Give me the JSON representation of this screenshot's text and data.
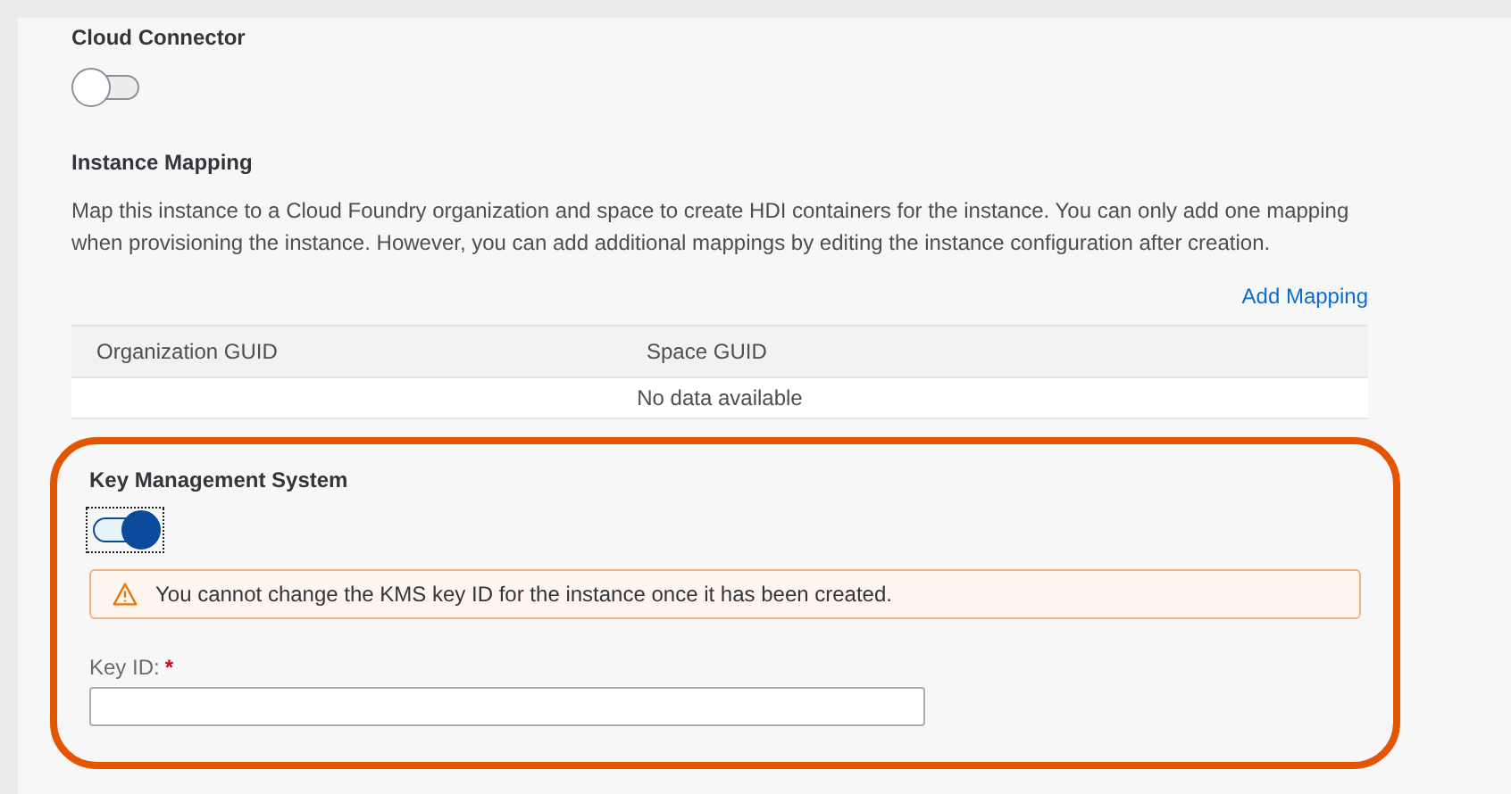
{
  "cloud_connector": {
    "title": "Cloud Connector",
    "toggle": {
      "on": false,
      "focused": false
    }
  },
  "instance_mapping": {
    "title": "Instance Mapping",
    "description": "Map this instance to a Cloud Foundry organization and space to create HDI containers for the instance. You can only add one mapping when provisioning the instance. However, you can add additional mappings by editing the instance configuration after creation.",
    "add_link": "Add Mapping",
    "table": {
      "columns": [
        "Organization GUID",
        "Space GUID"
      ],
      "empty_text": "No data available"
    }
  },
  "key_management": {
    "title": "Key Management System",
    "toggle": {
      "on": true,
      "focused": true
    },
    "warning": "You cannot change the KMS key ID for the instance once it has been created.",
    "field": {
      "label": "Key ID:",
      "required": true,
      "required_mark": "*"
    }
  }
}
